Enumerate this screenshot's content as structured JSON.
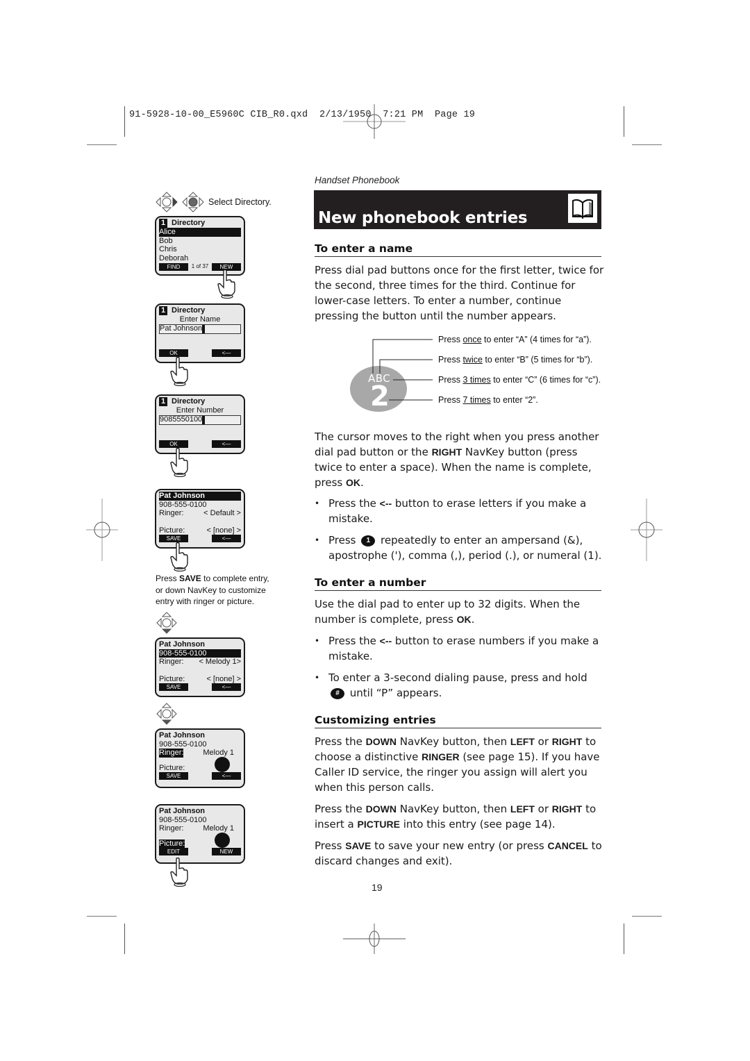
{
  "slug": "91-5928-10-00_E5960C CIB_R0.qxd  2/13/1950  7:21 PM  Page 19",
  "section_label": "Handset Phonebook",
  "title": "New phonebook entries",
  "title_icon": "open-book-icon",
  "left_column": {
    "nav_caption": "Select Directory.",
    "screens": [
      {
        "title_num": "1",
        "title": "Directory",
        "list": [
          "Alice",
          "Bob",
          "Chris",
          "Deborah"
        ],
        "selected": "Alice",
        "soft_left": "FIND",
        "counter": "1 of 37",
        "soft_right": "NEW"
      },
      {
        "title_num": "1",
        "title": "Directory",
        "prompt": "Enter Name",
        "field_value": "Pat Johnson",
        "soft_left": "OK",
        "soft_right": "<—"
      },
      {
        "title_num": "1",
        "title": "Directory",
        "prompt": "Enter Number",
        "field_value": "9085550100",
        "soft_left": "OK",
        "soft_right": "<—"
      },
      {
        "name": "Pat Johnson",
        "number": "908-555-0100",
        "ringer_label": "Ringer:",
        "ringer_value": "< Default >",
        "picture_label": "Picture:",
        "picture_value": "< [none] >",
        "soft_left": "SAVE",
        "soft_right": "<—"
      },
      {
        "name": "Pat Johnson",
        "number": "908-555-0100",
        "ringer_label": "Ringer:",
        "ringer_value": "< Melody 1>",
        "picture_label": "Picture:",
        "picture_value": "< [none] >",
        "soft_left": "SAVE",
        "soft_right": "<—"
      },
      {
        "name": "Pat Johnson",
        "number": "908-555-0100",
        "ringer_label": "Ringer:",
        "ringer_value": "Melody 1",
        "picture_label": "Picture:",
        "soft_left": "SAVE",
        "soft_right": "<—"
      },
      {
        "name": "Pat Johnson",
        "number": "908-555-0100",
        "ringer_label": "Ringer:",
        "ringer_value": "Melody 1",
        "picture_label": "Picture:",
        "soft_left": "EDIT",
        "soft_right": "NEW"
      }
    ],
    "note_prefix": "Press ",
    "note_bold": "SAVE",
    "note_suffix": " to complete entry, or down NavKey to customize entry with ringer or picture."
  },
  "sections": {
    "enter_name": {
      "heading": "To enter a name",
      "intro": "Press dial pad buttons once for the first letter, twice for the second, three times for the third. Continue for lower-case letters. To enter a number, continue pressing the button until the number appears.",
      "key_letters": "ABC",
      "key_number": "2",
      "callouts": [
        {
          "pre": "Press ",
          "u": "once",
          "post": " to enter “A” (4 times for “a”)."
        },
        {
          "pre": "Press ",
          "u": "twice",
          "post": " to enter “B” (5 times for “b”)."
        },
        {
          "pre": "Press ",
          "u": "3 times",
          "post": " to enter “C” (6 times for “c”)."
        },
        {
          "pre": "Press ",
          "u": "7 times",
          "post": " to enter “2”."
        }
      ],
      "cursor_p1": "The cursor moves to the right when you press another dial pad button or the ",
      "cursor_b1": "RIGHT",
      "cursor_p2": " NavKey button (press twice to enter a space). When the name is complete, press ",
      "cursor_b2": "OK",
      "cursor_p3": ".",
      "bullet1_pre": "Press the ",
      "bullet1_b": "<--",
      "bullet1_post": " button to erase letters if you make a mistake.",
      "bullet2_pre": "Press ",
      "bullet2_key": "1",
      "bullet2_post": " repeatedly to enter an ampersand (&), apostrophe ('), comma (,), period (.), or numeral (1)."
    },
    "enter_number": {
      "heading": "To enter a number",
      "intro_pre": "Use the dial pad to enter up to 32 digits. When the number is complete, press ",
      "intro_b": "OK",
      "intro_post": ".",
      "bullet1_pre": "Press the ",
      "bullet1_b": "<--",
      "bullet1_post": " button to erase numbers if you make a mistake.",
      "bullet2_pre": "To enter a 3-second dialing pause, press and hold ",
      "bullet2_key": "#",
      "bullet2_post": " until “P” appears."
    },
    "customizing": {
      "heading": "Customizing entries",
      "p1_a": "Press the ",
      "p1_b1": "DOWN",
      "p1_c": " NavKey button, then ",
      "p1_b2": "LEFT",
      "p1_d": " or ",
      "p1_b3": "RIGHT",
      "p1_e": " to choose a distinctive ",
      "p1_b4": "RINGER",
      "p1_f": " (see page 15). If you have Caller ID service, the ringer you assign will alert you when this person calls.",
      "p2_a": "Press the ",
      "p2_b1": "DOWN",
      "p2_c": " NavKey button, then ",
      "p2_b2": "LEFT",
      "p2_d": " or ",
      "p2_b3": "RIGHT",
      "p2_e": " to insert a ",
      "p2_b4": "PICTURE",
      "p2_f": " into this entry (see page 14).",
      "p3_a": "Press ",
      "p3_b1": "SAVE",
      "p3_c": " to save your new entry (or press ",
      "p3_b2": "CANCEL",
      "p3_d": " to discard changes and exit)."
    }
  },
  "page_number": "19"
}
